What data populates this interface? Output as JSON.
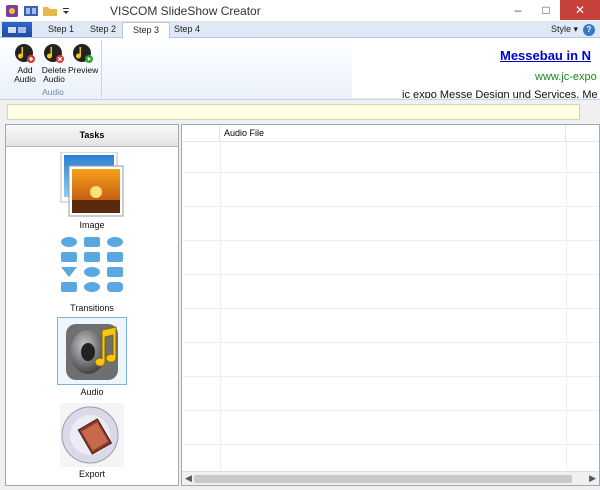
{
  "window": {
    "title": "VISCOM SlideShow Creator"
  },
  "quick_access": [
    "app-icon",
    "film-icon",
    "folder-icon",
    "dropdown-icon"
  ],
  "window_buttons": [
    "minimize-icon",
    "maximize-icon",
    "close-icon"
  ],
  "tabs": [
    {
      "label": "Step 1"
    },
    {
      "label": "Step 2"
    },
    {
      "label": "Step 3"
    },
    {
      "label": "Step 4"
    }
  ],
  "active_tab": "Step 3",
  "style_menu": {
    "label": "Style"
  },
  "ribbon": {
    "group_label": "Audio",
    "buttons": [
      {
        "label": "Add Audio",
        "line1": "Add",
        "line2": "Audio"
      },
      {
        "label": "Delete Audio",
        "line1": "Delete",
        "line2": "Audio"
      },
      {
        "label": "Preview",
        "line1": "Preview",
        "line2": ""
      }
    ]
  },
  "ad": {
    "line1": "Messebau in N",
    "line2": "www.jc-expo",
    "line3": "jc expo Messe Design und Services. Me"
  },
  "tasks": {
    "header": "Tasks",
    "items": [
      {
        "label": "Image"
      },
      {
        "label": "Transitions"
      },
      {
        "label": "Audio",
        "selected": true
      },
      {
        "label": "Export"
      }
    ]
  },
  "audio_list": {
    "columns": [
      "",
      "Audio File"
    ],
    "rows": []
  },
  "colors": {
    "accent": "#3a78c9",
    "close": "#c7413a",
    "ad_link": "#0000cc",
    "ad_url": "#1a8a1a"
  }
}
